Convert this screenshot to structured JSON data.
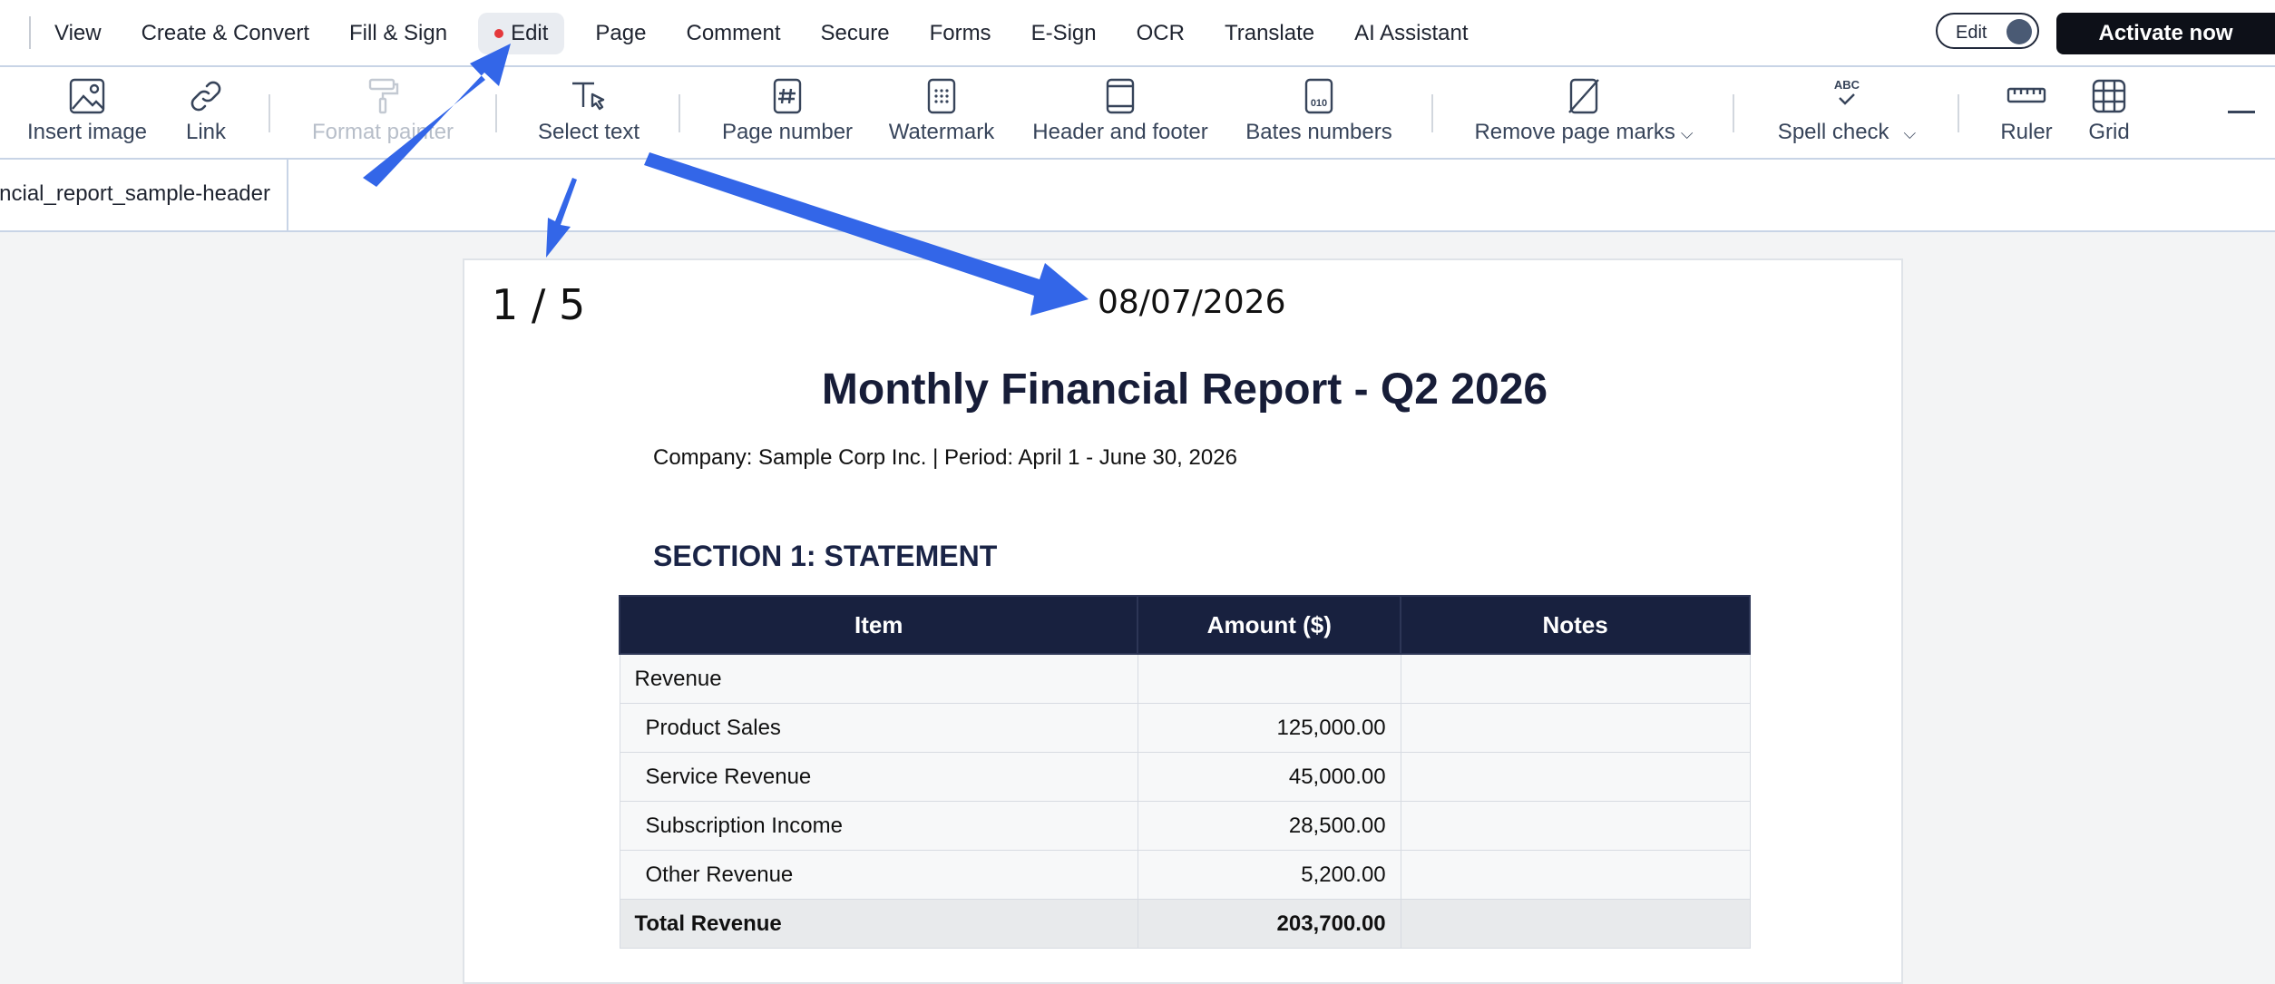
{
  "menu": {
    "items": [
      "View",
      "Create & Convert",
      "Fill & Sign",
      "Edit",
      "Page",
      "Comment",
      "Secure",
      "Forms",
      "E-Sign",
      "OCR",
      "Translate",
      "AI Assistant"
    ],
    "active_item": "Edit",
    "edit_toggle_label": "Edit",
    "activate_label": "Activate now"
  },
  "toolbar": {
    "insert_image": "Insert image",
    "link": "Link",
    "format_painter": "Format painter",
    "select_text": "Select text",
    "page_number": "Page number",
    "watermark": "Watermark",
    "header_footer": "Header and footer",
    "bates_numbers": "Bates numbers",
    "bates_icon_text": "010",
    "remove_page_marks": "Remove page marks",
    "spell_check": "Spell check",
    "spell_icon_text": "ABC",
    "ruler": "Ruler",
    "grid": "Grid"
  },
  "tab": {
    "label": "financial_report_sample-header"
  },
  "document": {
    "page_indicator": "1 / 5",
    "date": "08/07/2026",
    "title": "Monthly Financial Report - Q2 2026",
    "company_line": "Company: Sample Corp Inc. | Period: April 1 - June 30, 2026",
    "section_heading": "SECTION 1: STATEMENT",
    "table": {
      "headers": [
        "Item",
        "Amount ($)",
        "Notes"
      ],
      "rows": [
        {
          "item": "Revenue",
          "amount": "",
          "notes": ""
        },
        {
          "item": "Product Sales",
          "amount": "125,000.00",
          "notes": ""
        },
        {
          "item": "Service Revenue",
          "amount": "45,000.00",
          "notes": ""
        },
        {
          "item": "Subscription Income",
          "amount": "28,500.00",
          "notes": ""
        },
        {
          "item": "Other Revenue",
          "amount": "5,200.00",
          "notes": ""
        },
        {
          "item": "Total Revenue",
          "amount": "203,700.00",
          "notes": ""
        }
      ]
    }
  },
  "colors": {
    "accent_arrow": "#3366e8",
    "table_header": "#18213f",
    "red_dot": "#e5383b",
    "activate_button": "#0d1018"
  }
}
